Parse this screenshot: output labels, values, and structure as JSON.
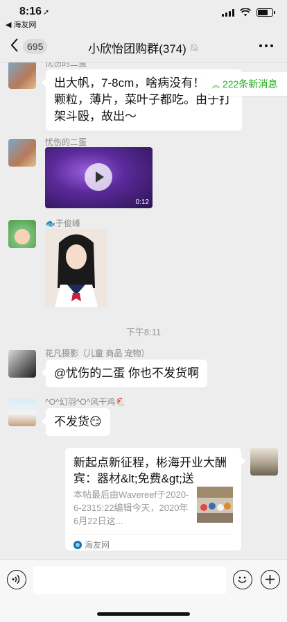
{
  "status": {
    "time": "8:16",
    "back_app": "◀ 海友网",
    "battery_level": 0.7
  },
  "nav": {
    "unread_count": "695",
    "title": "小欣怡团购群(374)"
  },
  "new_messages": {
    "label": "222条新消息"
  },
  "messages": [
    {
      "sender": "忧伤的二蛋",
      "text": "出大帆，7-8cm，啥病没有！大小颗粒，薄片，菜叶子都吃。由于打架斗殴，故出～"
    },
    {
      "sender": "忧伤的二蛋",
      "video_duration": "0:12"
    },
    {
      "sender": "于俊峰"
    },
    {
      "sender": "花凡摄影（儿童 商品 宠物）",
      "text": "@忧伤的二蛋 你也不发货啊"
    },
    {
      "sender": "^O^幻羽^O^风干鸡🐔",
      "text": "不发货😏"
    }
  ],
  "time_separator": "下午8:11",
  "link_card": {
    "title": "新起点新征程，彬海开业大酬宾：器材&lt;免费&gt;送",
    "description": "本帖最后由Wavereef于2020-6-2315:22编辑今天，2020年6月22日这...",
    "source": "海友网"
  },
  "colors": {
    "accent_green": "#1aad19",
    "bg": "#ededed"
  },
  "icons": [
    "back-chevron-icon",
    "mute-icon",
    "more-icon",
    "play-icon",
    "voice-icon",
    "emoji-icon",
    "plus-icon"
  ]
}
